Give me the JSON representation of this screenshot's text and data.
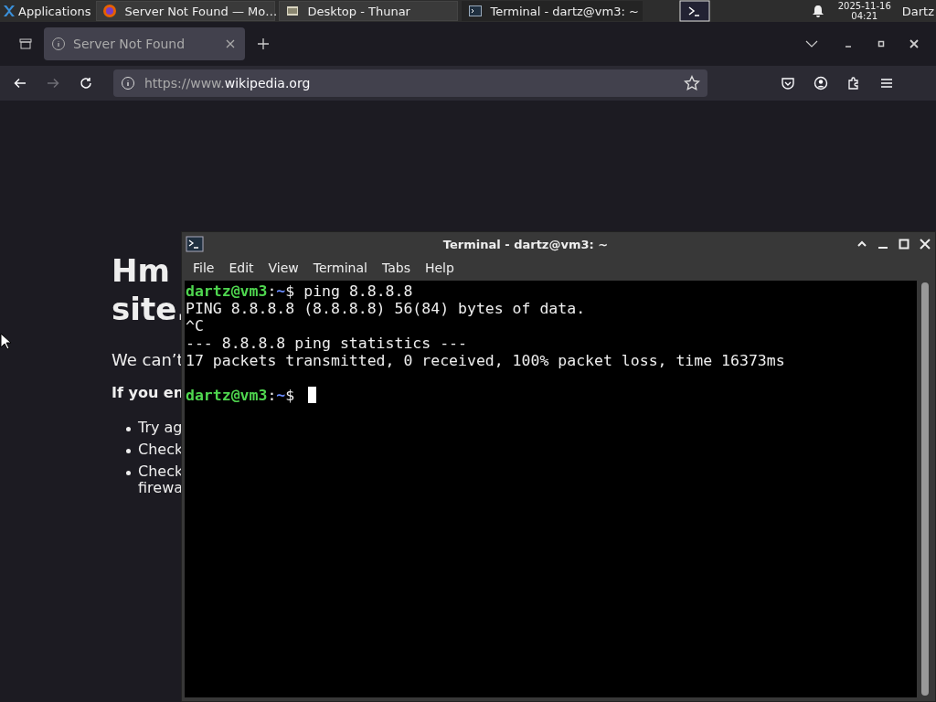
{
  "taskbar": {
    "apps_menu": "Applications",
    "tasks": [
      {
        "kind": "browser",
        "title": "Server Not Found — Mo…",
        "selected": false
      },
      {
        "kind": "folder",
        "title": "Desktop - Thunar",
        "selected": false
      },
      {
        "kind": "terminal",
        "title": "Terminal - dartz@vm3: ~",
        "selected": true
      }
    ],
    "clock": {
      "date": "2025-11-16",
      "time": "04:21"
    },
    "user": "Dartz"
  },
  "browser": {
    "tab": {
      "title": "Server Not Found",
      "selected": true
    },
    "nav": {
      "back_disabled": false,
      "forward_disabled": true
    },
    "url": {
      "prefix": "https://www.",
      "domain": "wikipedia.org"
    },
    "page": {
      "heading": [
        "Hm",
        "site."
      ],
      "message": "We can’t",
      "subheading": "If you en",
      "bullets": [
        [
          "Try ag"
        ],
        [
          "Check"
        ],
        [
          "Check",
          "firewa"
        ]
      ]
    }
  },
  "terminal": {
    "title": "Terminal - dartz@vm3: ~",
    "menu": [
      "File",
      "Edit",
      "View",
      "Terminal",
      "Tabs",
      "Help"
    ],
    "lines": [
      {
        "kind": "prompt",
        "user": "dartz@vm3",
        "separator": ":",
        "path": "~",
        "symbol": "$",
        "command": "ping 8.8.8.8"
      },
      {
        "kind": "output",
        "text": "PING 8.8.8.8 (8.8.8.8) 56(84) bytes of data."
      },
      {
        "kind": "output",
        "text": "^C"
      },
      {
        "kind": "output",
        "text": "--- 8.8.8.8 ping statistics ---"
      },
      {
        "kind": "output",
        "text": "17 packets transmitted, 0 received, 100% packet loss, time 16373ms"
      },
      {
        "kind": "blank"
      },
      {
        "kind": "prompt",
        "user": "dartz@vm3",
        "separator": ":",
        "path": "~",
        "symbol": "$",
        "cursor": true
      }
    ]
  }
}
